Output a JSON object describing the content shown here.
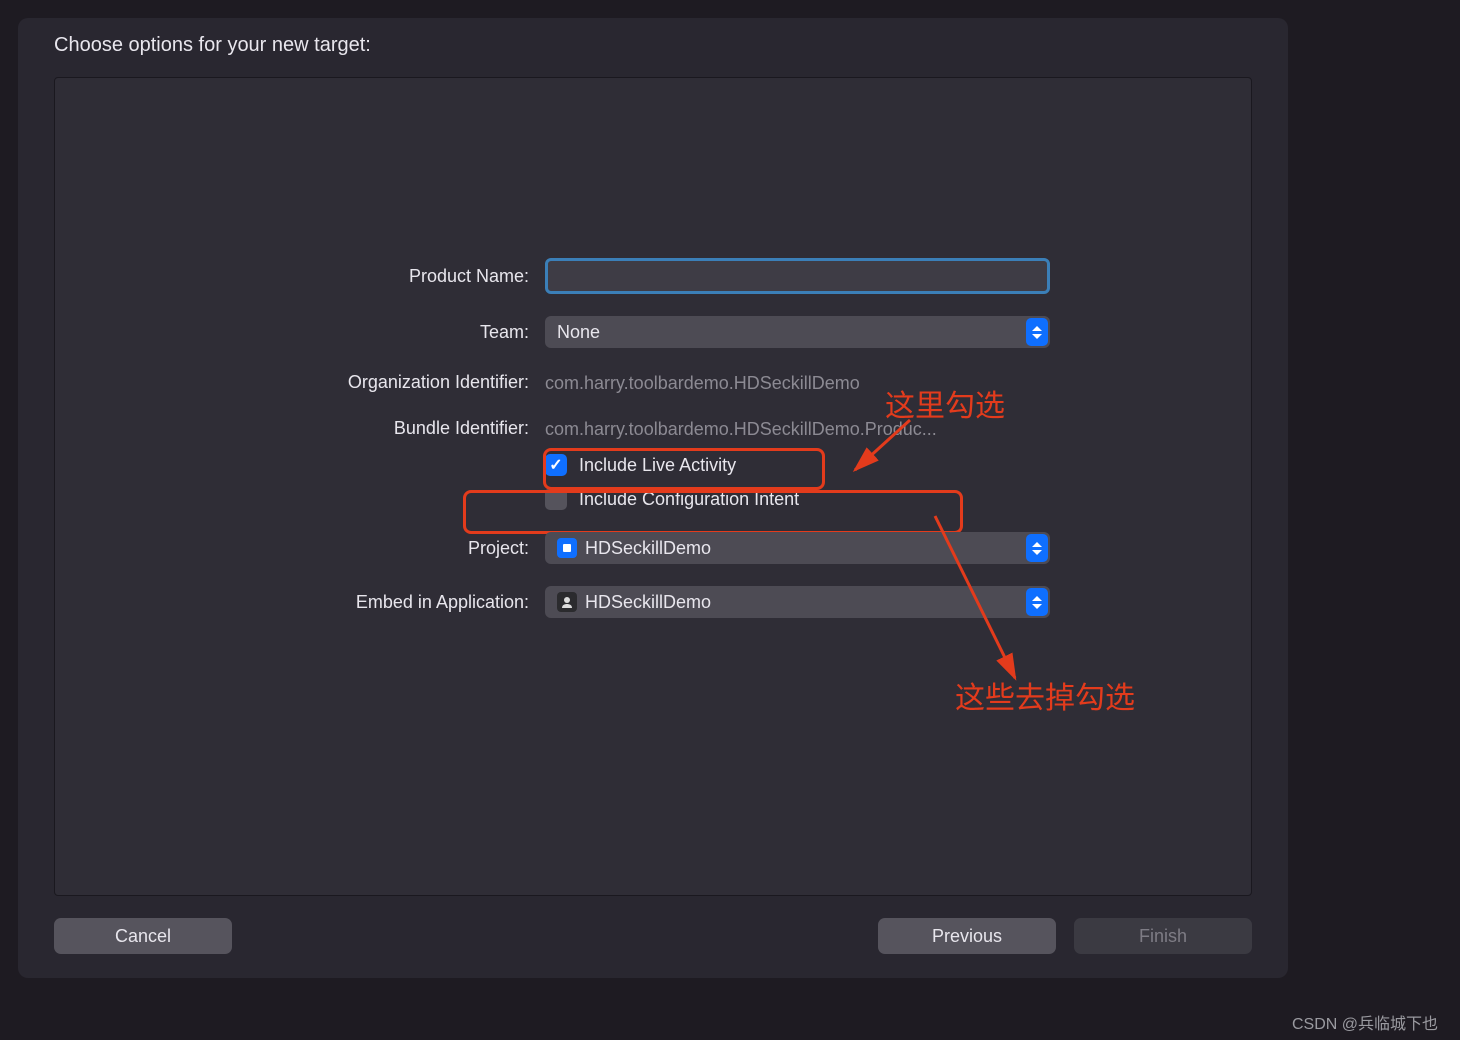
{
  "title": "Choose options for your new target:",
  "form": {
    "product_name": {
      "label": "Product Name:",
      "value": ""
    },
    "team": {
      "label": "Team:",
      "value": "None"
    },
    "org_id": {
      "label": "Organization Identifier:",
      "value": "com.harry.toolbardemo.HDSeckillDemo"
    },
    "bundle_id": {
      "label": "Bundle Identifier:",
      "value": "com.harry.toolbardemo.HDSeckillDemo.Produc..."
    },
    "live_activity": {
      "label": "Include Live Activity",
      "checked": true
    },
    "config_intent": {
      "label": "Include Configuration Intent",
      "checked": false
    },
    "project": {
      "label": "Project:",
      "value": "HDSeckillDemo"
    },
    "embed": {
      "label": "Embed in Application:",
      "value": "HDSeckillDemo"
    }
  },
  "buttons": {
    "cancel": "Cancel",
    "previous": "Previous",
    "finish": "Finish"
  },
  "annotations": {
    "check_here": "这里勾选",
    "uncheck_here": "这些去掉勾选"
  },
  "watermark": "CSDN @兵临城下也"
}
